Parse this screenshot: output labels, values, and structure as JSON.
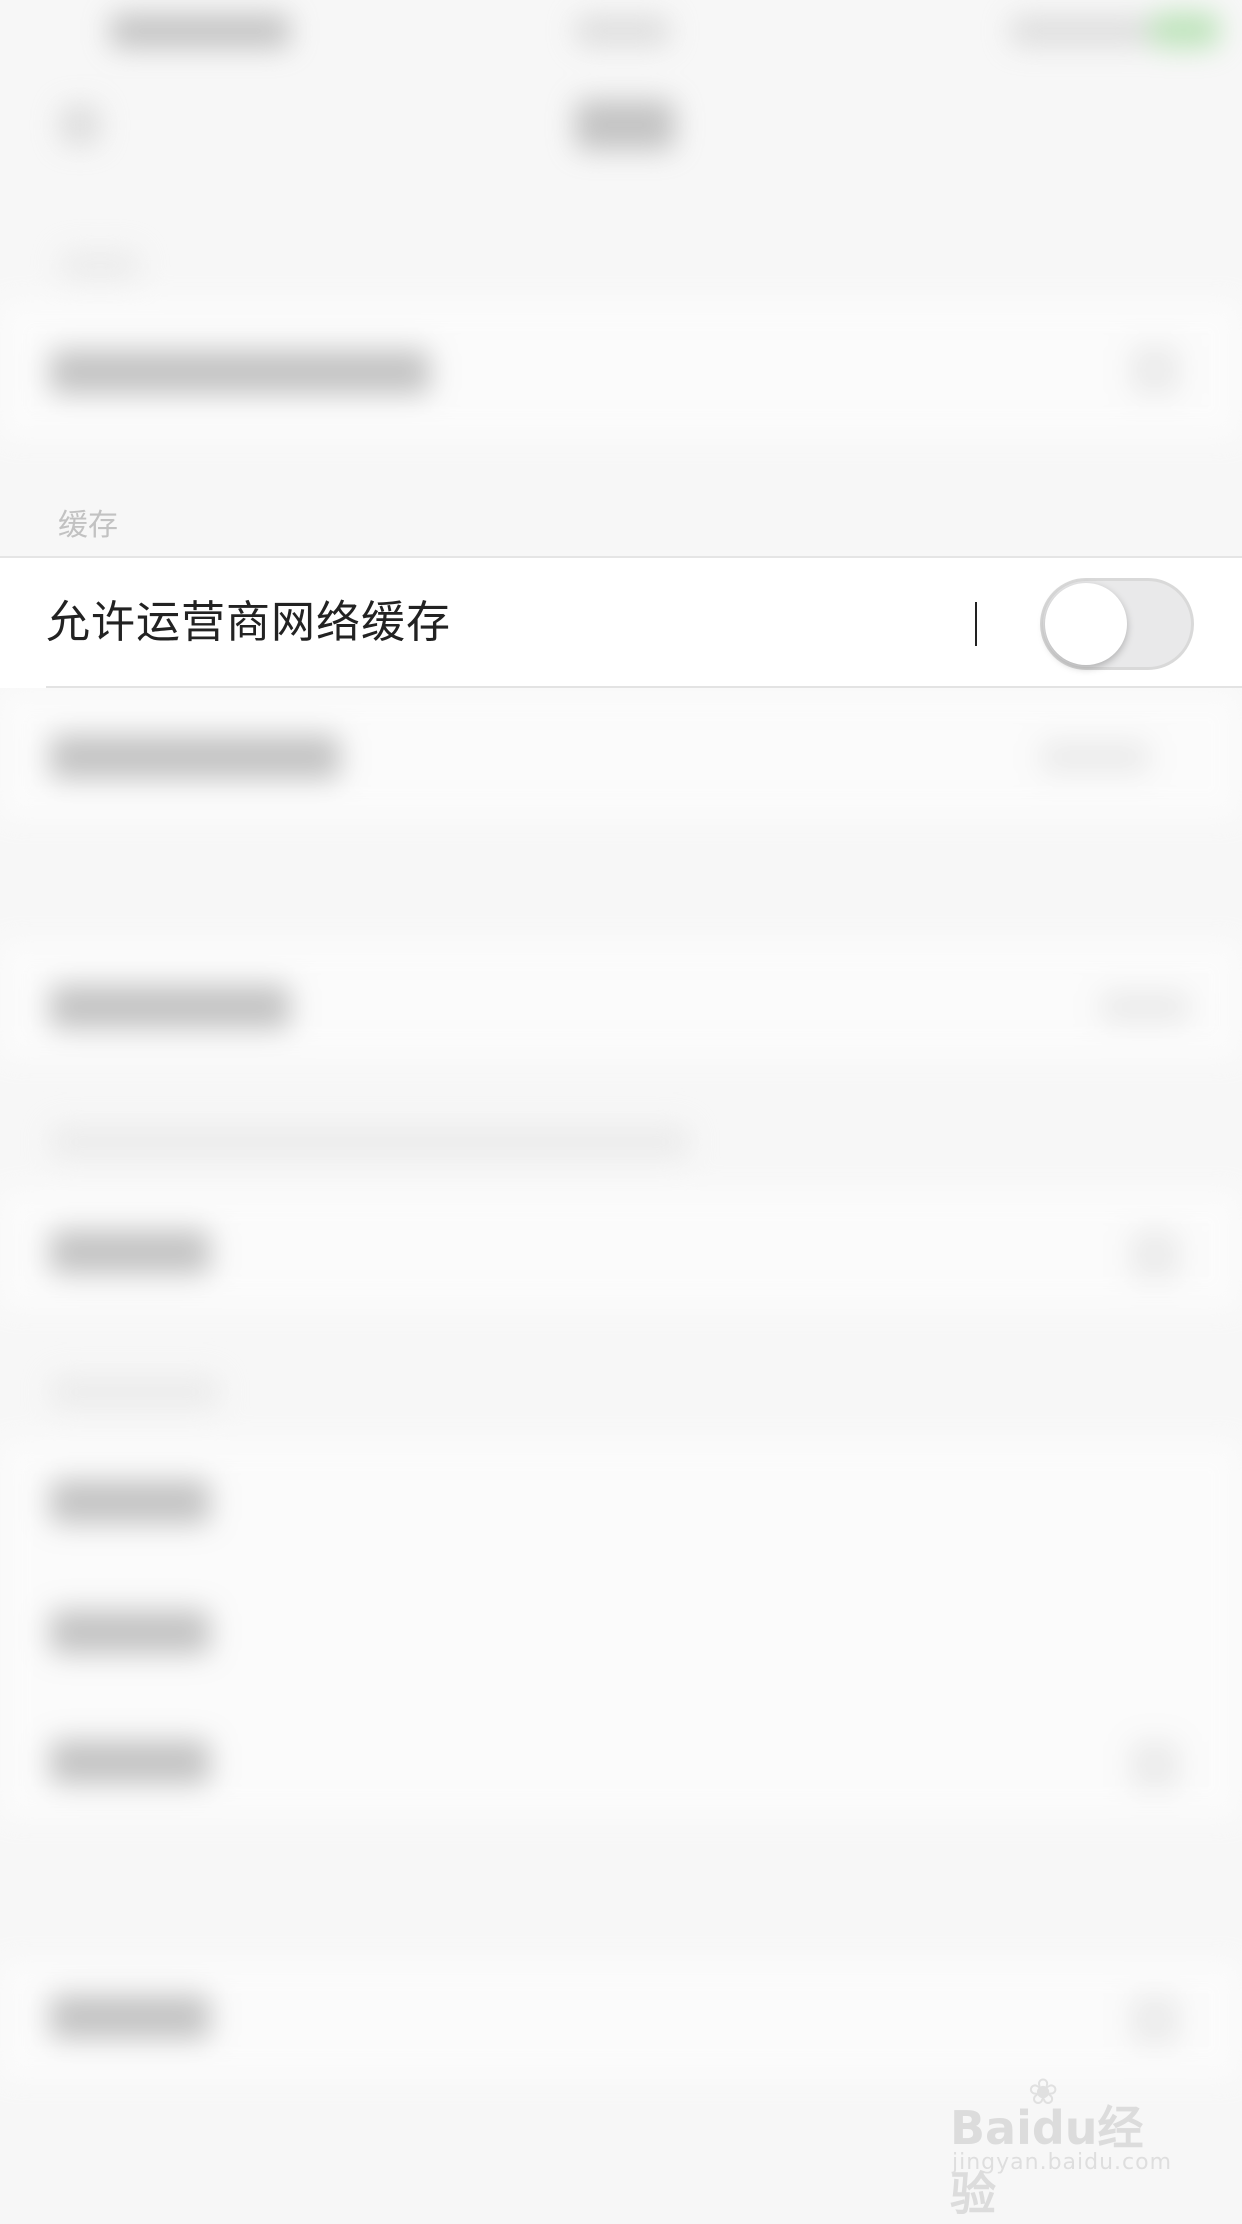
{
  "setting": {
    "label": "允许运营商网络缓存",
    "enabled": false
  },
  "watermark": {
    "logo_text": "Baidu经验",
    "url": "jingyan.baidu.com"
  },
  "background_section_fragment": "缓存"
}
